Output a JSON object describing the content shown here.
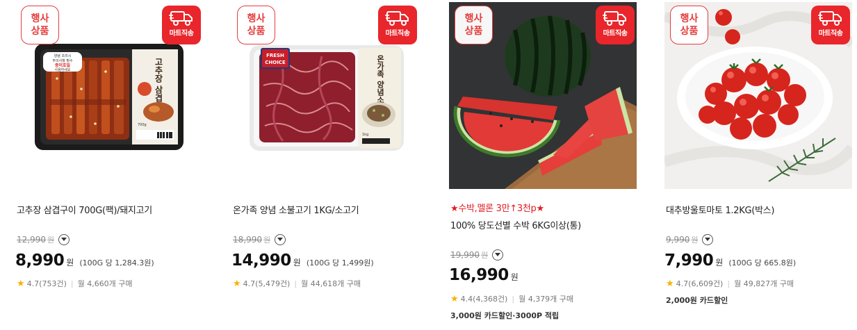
{
  "badges": {
    "event_line1": "행사",
    "event_line2": "상품",
    "mart": "마트직송"
  },
  "products": [
    {
      "name": "고추장 삼겹구이 700G(팩)/돼지고기",
      "promo": "",
      "original_price": "12,990",
      "price": "8,990",
      "currency": "원",
      "unit_price": "(100G 당 1,284.3원)",
      "rating": "4.7",
      "reviews": "(753건)",
      "monthly": "월 4,660개 구매",
      "benefit": "",
      "package_text": {
        "title": "고추장 삼겹구이",
        "sticker1": "양념 조리시",
        "sticker2": "주의사항 필수",
        "sticker3": "종이호일",
        "sticker4": "사용하세요",
        "weight": "700g"
      }
    },
    {
      "name": "온가족 양념 소불고기 1KG/소고기",
      "promo": "",
      "original_price": "18,990",
      "price": "14,990",
      "currency": "원",
      "unit_price": "(100G 당 1,499원)",
      "rating": "4.7",
      "reviews": "(5,479건)",
      "monthly": "월 44,618개 구매",
      "benefit": "",
      "package_text": {
        "title": "온가족 양념소불고기",
        "brand1": "FRESH",
        "brand2": "CHOICE",
        "weight": "1kg"
      }
    },
    {
      "name": "100% 당도선별 수박 6KG이상(통)",
      "promo": "★수박,멜론 3만↑3천p★",
      "original_price": "19,990",
      "price": "16,990",
      "currency": "원",
      "unit_price": "",
      "rating": "4.4",
      "reviews": "(4,368건)",
      "monthly": "월 4,379개 구매",
      "benefit": "3,000원 카드할인·3000P 적립"
    },
    {
      "name": "대추방울토마토 1.2KG(박스)",
      "promo": "",
      "original_price": "9,990",
      "price": "7,990",
      "currency": "원",
      "unit_price": "(100G 당 665.8원)",
      "rating": "4.7",
      "reviews": "(6,609건)",
      "monthly": "월 49,827개 구매",
      "benefit": "2,000원 카드할인"
    }
  ],
  "icons": {
    "toggle": "chevron-down-icon",
    "star": "star-icon",
    "truck": "truck-icon"
  },
  "colors": {
    "accent_red": "#e8262b",
    "star": "#f5b301",
    "promo_red": "#e21b22"
  }
}
